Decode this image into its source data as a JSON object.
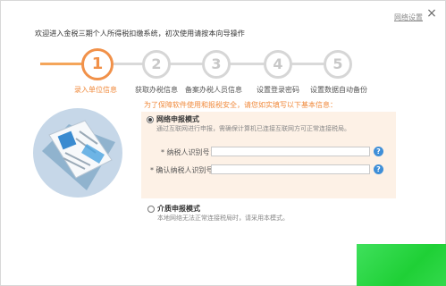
{
  "header": {
    "net_settings": "网络设置",
    "close": "×",
    "welcome": "欢迎进入金税三期个人所得税扣缴系统，初次使用请按本向导操作"
  },
  "steps": [
    {
      "num": "1",
      "label": "录入单位信息",
      "active": true
    },
    {
      "num": "2",
      "label": "获取办税信息",
      "active": false
    },
    {
      "num": "3",
      "label": "备案办税人员信息",
      "active": false
    },
    {
      "num": "4",
      "label": "设置登录密码",
      "active": false
    },
    {
      "num": "5",
      "label": "设置数据自动备份",
      "active": false
    }
  ],
  "tip": "为了保障软件使用和报税安全，请您如实填写以下基本信息：",
  "network_mode": {
    "title": "网络申报模式",
    "desc": "通过互联网进行申报，需确保计算机已连接互联网方可正常连接税局。",
    "taxpayer_id_label": "* 纳税人识别号：",
    "taxpayer_id_value": "",
    "confirm_id_label": "* 确认纳税人识别号：",
    "confirm_id_value": "",
    "help": "?"
  },
  "media_mode": {
    "title": "介质申报模式",
    "desc": "本地网络无法正常连接税局时，请采用本模式。"
  },
  "colors": {
    "accent": "#f19149",
    "help_blue": "#3f8fd8",
    "panel_bg": "#fdf1e6"
  }
}
